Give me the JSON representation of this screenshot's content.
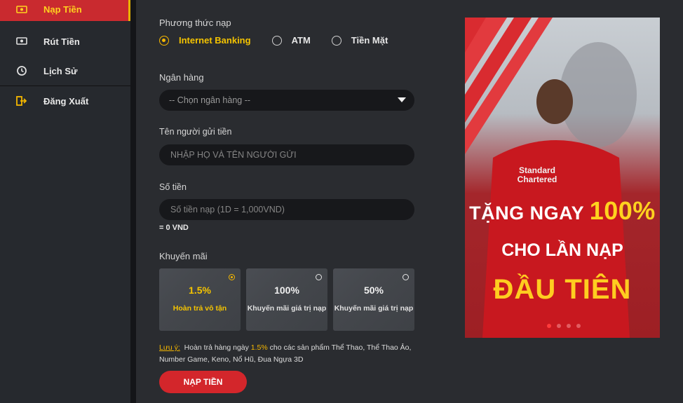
{
  "sidebar": {
    "items": [
      {
        "label": "Nạp Tiền",
        "icon": "deposit-icon"
      },
      {
        "label": "Rút Tiền",
        "icon": "withdraw-icon"
      },
      {
        "label": "Lịch Sử",
        "icon": "history-icon"
      },
      {
        "label": "Đăng Xuất",
        "icon": "logout-icon"
      }
    ]
  },
  "form": {
    "method_label": "Phương thức nạp",
    "methods": [
      "Internet Banking",
      "ATM",
      "Tiền Mặt"
    ],
    "bank_label": "Ngân hàng",
    "bank_placeholder": "-- Chọn ngân hàng --",
    "sender_label": "Tên người gửi tiền",
    "sender_placeholder": "NHẬP HỌ VÀ TÊN NGƯỜI GỬI",
    "amount_label": "Số tiền",
    "amount_placeholder": "Số tiền nạp (1D = 1,000VND)",
    "amount_converted": "= 0 VND",
    "promo_label": "Khuyến mãi",
    "promos": [
      {
        "pct": "1.5%",
        "desc": "Hoàn trả vô tận"
      },
      {
        "pct": "100%",
        "desc": "Khuyến mãi giá trị nạp"
      },
      {
        "pct": "50%",
        "desc": "Khuyến mãi giá trị nạp"
      }
    ],
    "note_prefix": "Lưu ý:",
    "note_before": "Hoàn trả hàng ngày",
    "note_highlight": "1.5%",
    "note_after": "cho các sản phẩm Thể Thao, Thể Thao Ảo, Number Game, Keno, Nổ Hũ, Đua Ngựa 3D",
    "submit_label": "NẠP TIỀN"
  },
  "banner": {
    "line1_a": "TẶNG NGAY",
    "line1_b": "100%",
    "line2": "CHO LẦN NẠP",
    "line3": "ĐẦU TIÊN",
    "sponsor": "Standard Chartered"
  },
  "colors": {
    "accent": "#f5b700",
    "brand_red": "#d3262b"
  }
}
